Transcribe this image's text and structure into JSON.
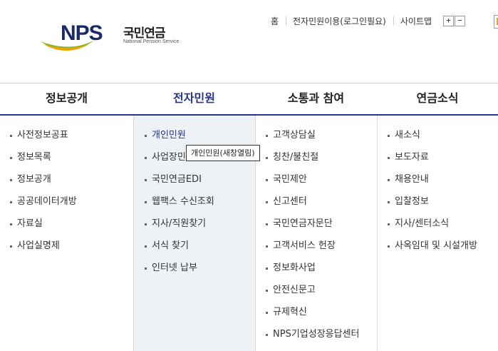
{
  "logo": {
    "mark": "NPS",
    "korean": "국민연금",
    "english": "National Pension Service"
  },
  "util_links": [
    "홈",
    "전자민원이용(로그인필요)",
    "사이트맵"
  ],
  "zoom": {
    "in": "+",
    "out": "−"
  },
  "gnb": [
    {
      "label": "정보공개"
    },
    {
      "label": "전자민원"
    },
    {
      "label": "소통과 참여"
    },
    {
      "label": "연금소식"
    }
  ],
  "menu": {
    "col1": [
      "사전정보공표",
      "정보목록",
      "정보공개",
      "공공데이터개방",
      "자료실",
      "사업실명제"
    ],
    "col2": [
      "개인민원",
      "사업장민원",
      "국민연금EDI",
      "웹팩스 수신조회",
      "지사/직원찾기",
      "서식 찾기",
      "인터넷 납부"
    ],
    "col3": [
      "고객상담실",
      "칭찬/불친절",
      "국민제안",
      "신고센터",
      "국민연금자문단",
      "고객서비스 헌장",
      "정보화사업",
      "안전신문고",
      "규제혁신",
      "NPS기업성장응답센터"
    ],
    "col4": [
      "새소식",
      "보도자료",
      "채용안내",
      "입찰정보",
      "지사/센터소식",
      "사옥임대 및 시설개방"
    ]
  },
  "tooltip": "개인민원(새창열림)",
  "colors": {
    "brand": "#27348b",
    "active_bg": "#eef2f6",
    "logo_green": "#7ab929",
    "logo_orange": "#f0a000"
  }
}
